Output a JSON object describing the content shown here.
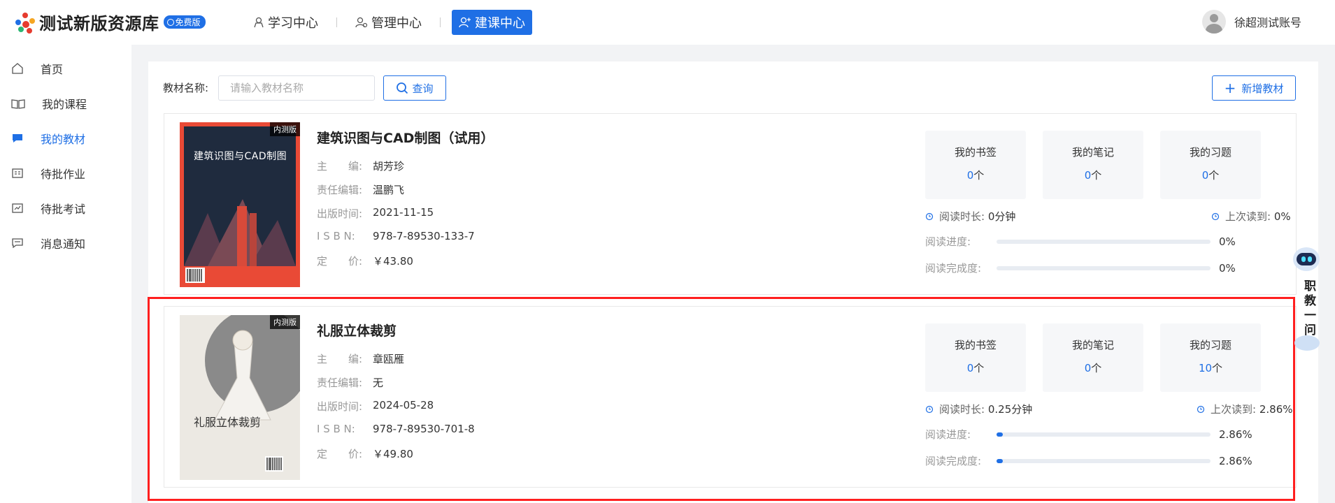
{
  "header": {
    "app_title": "测试新版资源库",
    "free_badge": "免费版",
    "nav": [
      {
        "label": "学习中心",
        "icon": "study-icon"
      },
      {
        "label": "管理中心",
        "icon": "manage-icon"
      },
      {
        "label": "建课中心",
        "icon": "build-course-icon",
        "active": true
      }
    ],
    "user_name": "徐超测试账号"
  },
  "sidebar": {
    "items": [
      {
        "label": "首页",
        "icon": "home-icon"
      },
      {
        "label": "我的课程",
        "icon": "book-open-icon"
      },
      {
        "label": "我的教材",
        "icon": "chat-bubble-icon",
        "active": true
      },
      {
        "label": "待批作业",
        "icon": "homework-icon"
      },
      {
        "label": "待批考试",
        "icon": "exam-icon"
      },
      {
        "label": "消息通知",
        "icon": "message-icon"
      }
    ]
  },
  "search": {
    "label": "教材名称:",
    "placeholder": "请输入教材名称",
    "value": "",
    "query_label": "查询",
    "add_label": "新增教材"
  },
  "books": [
    {
      "cover_tag": "内测版",
      "cover_title": "建筑识图与CAD制图",
      "title": "建筑识图与CAD制图（试用）",
      "meta": [
        {
          "k": "主　　编:",
          "v": "胡芳珍"
        },
        {
          "k": "责任编辑:",
          "v": "温鹏飞"
        },
        {
          "k": "出版时间:",
          "v": "2021-11-15"
        },
        {
          "k": "I S B N:",
          "v": "978-7-89530-133-7"
        },
        {
          "k": "定　　价:",
          "v": "￥43.80"
        }
      ],
      "stats": [
        {
          "title": "我的书签",
          "num": "0",
          "unit": "个"
        },
        {
          "title": "我的笔记",
          "num": "0",
          "unit": "个"
        },
        {
          "title": "我的习题",
          "num": "0",
          "unit": "个"
        }
      ],
      "read_time_label": "阅读时长:",
      "read_time": "0分钟",
      "last_read_label": "上次读到:",
      "last_read": "0%",
      "progress_label": "阅读进度:",
      "progress": 0,
      "progress_text": "0%",
      "completion_label": "阅读完成度:",
      "completion": 0,
      "completion_text": "0%"
    },
    {
      "cover_tag": "内测版",
      "cover_title": "礼服立体裁剪",
      "title": "礼服立体裁剪",
      "meta": [
        {
          "k": "主　　编:",
          "v": "章瓯雁"
        },
        {
          "k": "责任编辑:",
          "v": "无"
        },
        {
          "k": "出版时间:",
          "v": "2024-05-28"
        },
        {
          "k": "I S B N:",
          "v": "978-7-89530-701-8"
        },
        {
          "k": "定　　价:",
          "v": "￥49.80"
        }
      ],
      "stats": [
        {
          "title": "我的书签",
          "num": "0",
          "unit": "个"
        },
        {
          "title": "我的笔记",
          "num": "0",
          "unit": "个"
        },
        {
          "title": "我的习题",
          "num": "10",
          "unit": "个"
        }
      ],
      "read_time_label": "阅读时长:",
      "read_time": "0.25分钟",
      "last_read_label": "上次读到:",
      "last_read": "2.86%",
      "progress_label": "阅读进度:",
      "progress": 2.86,
      "progress_text": "2.86%",
      "completion_label": "阅读完成度:",
      "completion": 2.86,
      "completion_text": "2.86%"
    }
  ],
  "assistant": {
    "label": "职教一问"
  },
  "colors": {
    "accent": "#1f6fe5",
    "highlight": "#ff1f1f"
  }
}
